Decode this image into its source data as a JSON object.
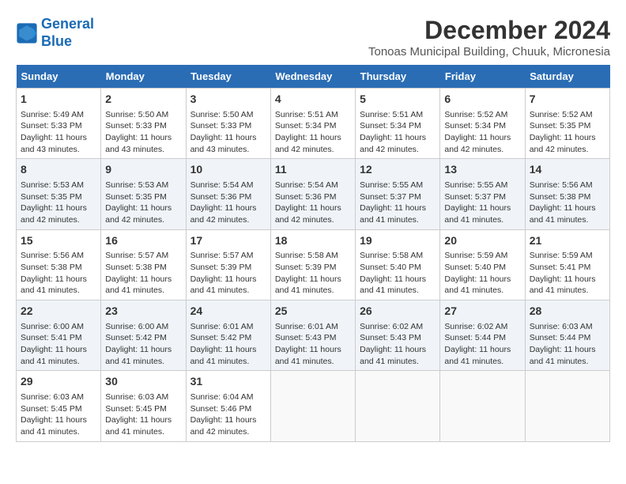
{
  "logo": {
    "line1": "General",
    "line2": "Blue"
  },
  "title": "December 2024",
  "subtitle": "Tonoas Municipal Building, Chuuk, Micronesia",
  "headers": [
    "Sunday",
    "Monday",
    "Tuesday",
    "Wednesday",
    "Thursday",
    "Friday",
    "Saturday"
  ],
  "weeks": [
    [
      {
        "day": "1",
        "info": "Sunrise: 5:49 AM\nSunset: 5:33 PM\nDaylight: 11 hours\nand 43 minutes."
      },
      {
        "day": "2",
        "info": "Sunrise: 5:50 AM\nSunset: 5:33 PM\nDaylight: 11 hours\nand 43 minutes."
      },
      {
        "day": "3",
        "info": "Sunrise: 5:50 AM\nSunset: 5:33 PM\nDaylight: 11 hours\nand 43 minutes."
      },
      {
        "day": "4",
        "info": "Sunrise: 5:51 AM\nSunset: 5:34 PM\nDaylight: 11 hours\nand 42 minutes."
      },
      {
        "day": "5",
        "info": "Sunrise: 5:51 AM\nSunset: 5:34 PM\nDaylight: 11 hours\nand 42 minutes."
      },
      {
        "day": "6",
        "info": "Sunrise: 5:52 AM\nSunset: 5:34 PM\nDaylight: 11 hours\nand 42 minutes."
      },
      {
        "day": "7",
        "info": "Sunrise: 5:52 AM\nSunset: 5:35 PM\nDaylight: 11 hours\nand 42 minutes."
      }
    ],
    [
      {
        "day": "8",
        "info": "Sunrise: 5:53 AM\nSunset: 5:35 PM\nDaylight: 11 hours\nand 42 minutes."
      },
      {
        "day": "9",
        "info": "Sunrise: 5:53 AM\nSunset: 5:35 PM\nDaylight: 11 hours\nand 42 minutes."
      },
      {
        "day": "10",
        "info": "Sunrise: 5:54 AM\nSunset: 5:36 PM\nDaylight: 11 hours\nand 42 minutes."
      },
      {
        "day": "11",
        "info": "Sunrise: 5:54 AM\nSunset: 5:36 PM\nDaylight: 11 hours\nand 42 minutes."
      },
      {
        "day": "12",
        "info": "Sunrise: 5:55 AM\nSunset: 5:37 PM\nDaylight: 11 hours\nand 41 minutes."
      },
      {
        "day": "13",
        "info": "Sunrise: 5:55 AM\nSunset: 5:37 PM\nDaylight: 11 hours\nand 41 minutes."
      },
      {
        "day": "14",
        "info": "Sunrise: 5:56 AM\nSunset: 5:38 PM\nDaylight: 11 hours\nand 41 minutes."
      }
    ],
    [
      {
        "day": "15",
        "info": "Sunrise: 5:56 AM\nSunset: 5:38 PM\nDaylight: 11 hours\nand 41 minutes."
      },
      {
        "day": "16",
        "info": "Sunrise: 5:57 AM\nSunset: 5:38 PM\nDaylight: 11 hours\nand 41 minutes."
      },
      {
        "day": "17",
        "info": "Sunrise: 5:57 AM\nSunset: 5:39 PM\nDaylight: 11 hours\nand 41 minutes."
      },
      {
        "day": "18",
        "info": "Sunrise: 5:58 AM\nSunset: 5:39 PM\nDaylight: 11 hours\nand 41 minutes."
      },
      {
        "day": "19",
        "info": "Sunrise: 5:58 AM\nSunset: 5:40 PM\nDaylight: 11 hours\nand 41 minutes."
      },
      {
        "day": "20",
        "info": "Sunrise: 5:59 AM\nSunset: 5:40 PM\nDaylight: 11 hours\nand 41 minutes."
      },
      {
        "day": "21",
        "info": "Sunrise: 5:59 AM\nSunset: 5:41 PM\nDaylight: 11 hours\nand 41 minutes."
      }
    ],
    [
      {
        "day": "22",
        "info": "Sunrise: 6:00 AM\nSunset: 5:41 PM\nDaylight: 11 hours\nand 41 minutes."
      },
      {
        "day": "23",
        "info": "Sunrise: 6:00 AM\nSunset: 5:42 PM\nDaylight: 11 hours\nand 41 minutes."
      },
      {
        "day": "24",
        "info": "Sunrise: 6:01 AM\nSunset: 5:42 PM\nDaylight: 11 hours\nand 41 minutes."
      },
      {
        "day": "25",
        "info": "Sunrise: 6:01 AM\nSunset: 5:43 PM\nDaylight: 11 hours\nand 41 minutes."
      },
      {
        "day": "26",
        "info": "Sunrise: 6:02 AM\nSunset: 5:43 PM\nDaylight: 11 hours\nand 41 minutes."
      },
      {
        "day": "27",
        "info": "Sunrise: 6:02 AM\nSunset: 5:44 PM\nDaylight: 11 hours\nand 41 minutes."
      },
      {
        "day": "28",
        "info": "Sunrise: 6:03 AM\nSunset: 5:44 PM\nDaylight: 11 hours\nand 41 minutes."
      }
    ],
    [
      {
        "day": "29",
        "info": "Sunrise: 6:03 AM\nSunset: 5:45 PM\nDaylight: 11 hours\nand 41 minutes."
      },
      {
        "day": "30",
        "info": "Sunrise: 6:03 AM\nSunset: 5:45 PM\nDaylight: 11 hours\nand 41 minutes."
      },
      {
        "day": "31",
        "info": "Sunrise: 6:04 AM\nSunset: 5:46 PM\nDaylight: 11 hours\nand 42 minutes."
      },
      {
        "day": "",
        "info": ""
      },
      {
        "day": "",
        "info": ""
      },
      {
        "day": "",
        "info": ""
      },
      {
        "day": "",
        "info": ""
      }
    ]
  ]
}
